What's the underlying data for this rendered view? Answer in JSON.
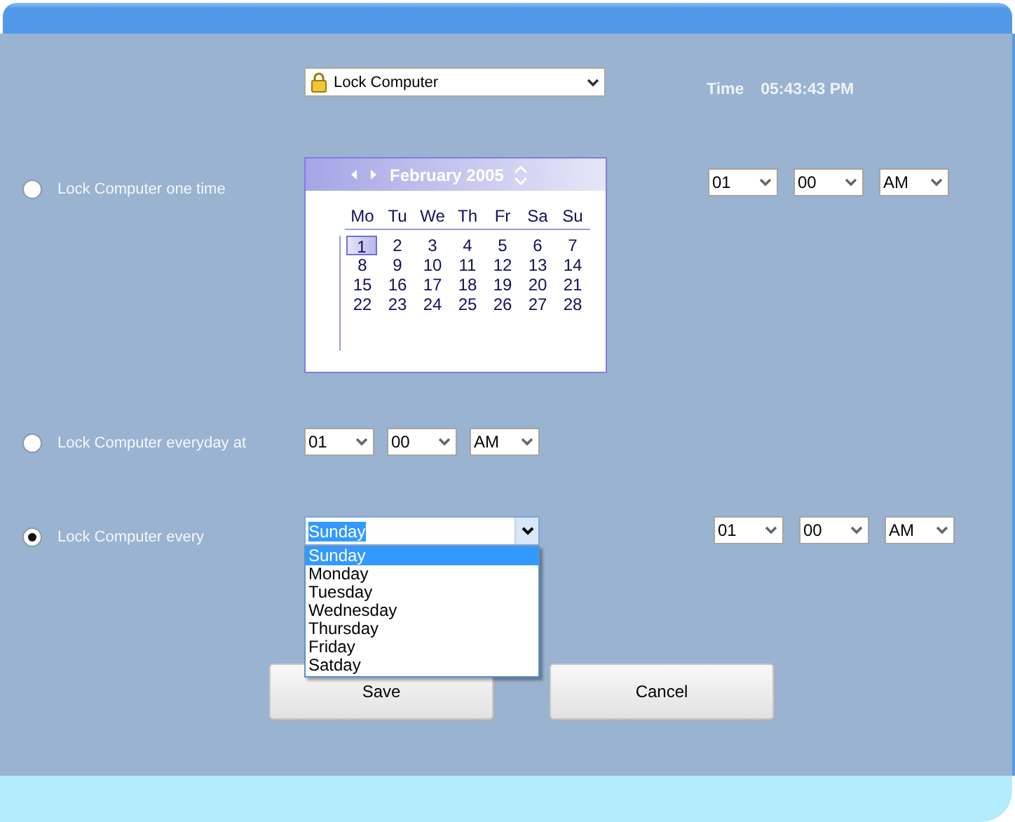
{
  "action_select": {
    "value": "Lock Computer"
  },
  "clock": {
    "label": "Time",
    "value": "05:43:43 PM"
  },
  "options": [
    {
      "kind": "calendar",
      "label": "Lock Computer one time",
      "selected": false,
      "calendar": {
        "title": "February 2005",
        "weekdays": [
          "Mo",
          "Tu",
          "We",
          "Th",
          "Fr",
          "Sa",
          "Su"
        ],
        "days": [
          {
            "label": "1",
            "selected": true
          },
          {
            "label": "2",
            "selected": false
          },
          {
            "label": "3",
            "selected": false
          },
          {
            "label": "4",
            "selected": false
          },
          {
            "label": "5",
            "selected": false
          },
          {
            "label": "6",
            "selected": false
          },
          {
            "label": "7",
            "selected": false
          },
          {
            "label": "8",
            "selected": false
          },
          {
            "label": "9",
            "selected": false
          },
          {
            "label": "10",
            "selected": false
          },
          {
            "label": "11",
            "selected": false
          },
          {
            "label": "12",
            "selected": false
          },
          {
            "label": "13",
            "selected": false
          },
          {
            "label": "14",
            "selected": false
          },
          {
            "label": "15",
            "selected": false
          },
          {
            "label": "16",
            "selected": false
          },
          {
            "label": "17",
            "selected": false
          },
          {
            "label": "18",
            "selected": false
          },
          {
            "label": "19",
            "selected": false
          },
          {
            "label": "20",
            "selected": false
          },
          {
            "label": "21",
            "selected": false
          },
          {
            "label": "22",
            "selected": false
          },
          {
            "label": "23",
            "selected": false
          },
          {
            "label": "24",
            "selected": false
          },
          {
            "label": "25",
            "selected": false
          },
          {
            "label": "26",
            "selected": false
          },
          {
            "label": "27",
            "selected": false
          },
          {
            "label": "28",
            "selected": false
          }
        ]
      },
      "time": {
        "hour": "01",
        "minute": "00",
        "period": "AM"
      }
    },
    {
      "kind": "daily",
      "label": "Lock Computer everyday at",
      "selected": false,
      "time": {
        "hour": "01",
        "minute": "00",
        "period": "AM"
      }
    },
    {
      "kind": "weekly",
      "label": "Lock Computer every",
      "selected": true,
      "day_combo": {
        "value": "Sunday",
        "expanded": true,
        "options": [
          {
            "label": "Sunday",
            "selected": true
          },
          {
            "label": "Monday",
            "selected": false
          },
          {
            "label": "Tuesday",
            "selected": false
          },
          {
            "label": "Wednesday",
            "selected": false
          },
          {
            "label": "Thursday",
            "selected": false
          },
          {
            "label": "Friday",
            "selected": false
          },
          {
            "label": "Satday",
            "selected": false
          }
        ]
      },
      "time": {
        "hour": "01",
        "minute": "00",
        "period": "AM"
      }
    }
  ],
  "buttons": [
    "Save",
    "Cancel"
  ]
}
